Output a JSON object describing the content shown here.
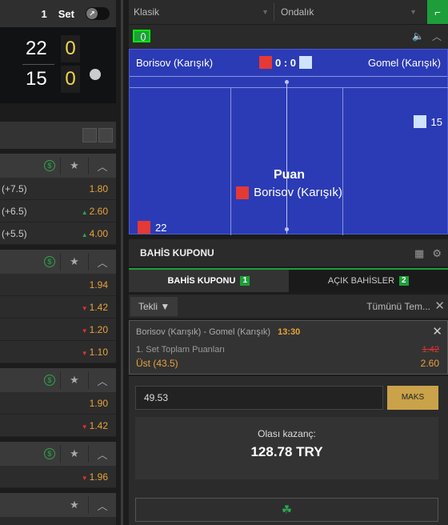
{
  "scoreboard": {
    "set_number": "1",
    "set_label": "Set",
    "home_points": "22",
    "away_points": "15",
    "home_sets": "0",
    "away_sets": "0"
  },
  "markets": [
    {
      "rows": [
        {
          "label": "(+7.5)",
          "odd": "1.80",
          "trend": ""
        },
        {
          "label": "(+6.5)",
          "odd": "2.60",
          "trend": "up"
        },
        {
          "label": "(+5.5)",
          "odd": "4.00",
          "trend": "up"
        }
      ]
    },
    {
      "rows": [
        {
          "label": "",
          "odd": "1.94",
          "trend": ""
        },
        {
          "label": "",
          "odd": "1.42",
          "trend": "down"
        },
        {
          "label": "",
          "odd": "1.20",
          "trend": "down"
        },
        {
          "label": "",
          "odd": "1.10",
          "trend": "down"
        }
      ]
    },
    {
      "rows": [
        {
          "label": "",
          "odd": "1.90",
          "trend": ""
        },
        {
          "label": "",
          "odd": "1.42",
          "trend": "down"
        }
      ]
    },
    {
      "rows": [
        {
          "label": "",
          "odd": "1.96",
          "trend": "down"
        }
      ]
    }
  ],
  "topbar": {
    "view_mode": "Klasik",
    "odds_format": "Ondalık"
  },
  "match": {
    "home_team": "Borisov (Karışık)",
    "away_team": "Gomel (Karışık)",
    "score": "0 : 0",
    "event_title": "Puan",
    "event_team": "Borisov (Karışık)",
    "home_player_number": "22",
    "away_player_number": "15"
  },
  "betslip": {
    "title": "BAHİS KUPONU",
    "tab_coupon": "BAHİS KUPONU",
    "tab_coupon_count": "1",
    "tab_open": "AÇIK BAHİSLER",
    "tab_open_count": "2",
    "bet_type": "Tekli",
    "clear_all": "Tümünü Tem...",
    "selection": {
      "match": "Borisov (Karışık) - Gomel (Karışık)",
      "time": "13:30",
      "market": "1. Set Toplam Puanları",
      "pick": "Üst (43.5)",
      "old_odd": "1.42",
      "new_odd": "2.60"
    },
    "stake": "49.53",
    "max_label": "MAKS",
    "potential_label": "Olası kazanç:",
    "potential_value": "128.78 TRY"
  },
  "colors": {
    "accent_green": "#1e9e3a",
    "odds_orange": "#e8a33a",
    "court_blue": "#2b3bb5",
    "home_shirt": "#e53935",
    "away_shirt": "#cfe3ff"
  }
}
